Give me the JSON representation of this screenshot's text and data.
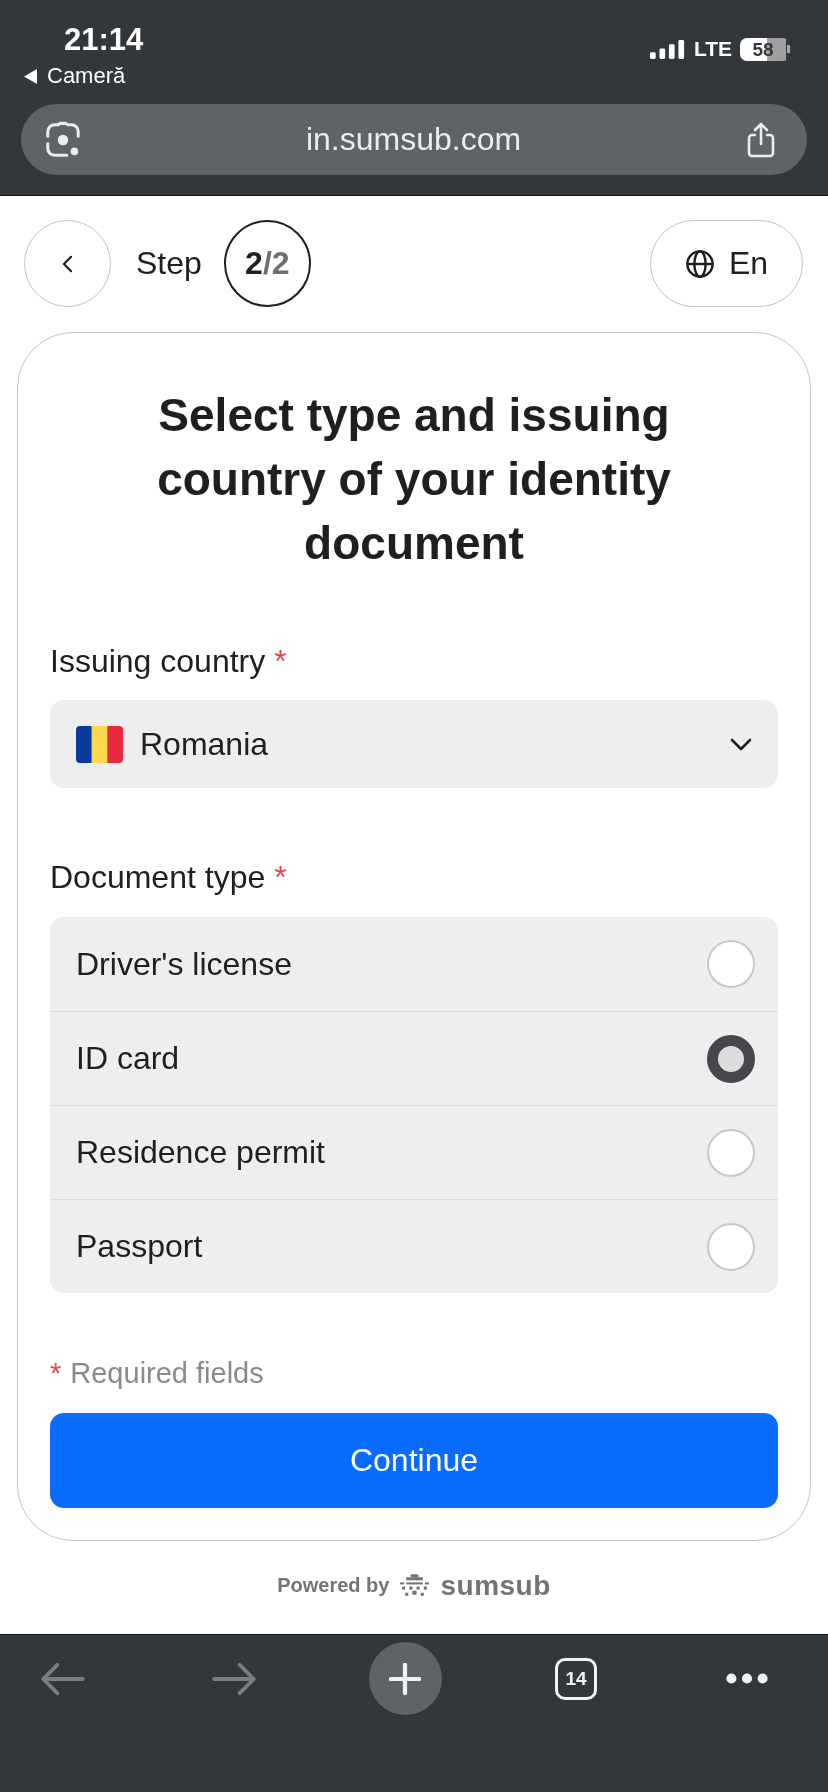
{
  "status_bar": {
    "time": "21:14",
    "back_app": "Cameră",
    "network": "LTE",
    "battery": "58"
  },
  "browser_bar": {
    "url": "in.sumsub.com"
  },
  "header": {
    "step_label": "Step",
    "step_counter": "**2**/2",
    "language": "En"
  },
  "form": {
    "title": "Select type and issuing country of your identity document",
    "country_field": {
      "label": "Issuing country",
      "required_mark": "*",
      "value": "Romania"
    },
    "document_field": {
      "label": "Document type",
      "required_mark": "*",
      "options": [
        {
          "label": "Driver's license",
          "selected": false
        },
        {
          "label": "ID card",
          "selected": true
        },
        {
          "label": "Residence permit",
          "selected": false
        },
        {
          "label": "Passport",
          "selected": false
        }
      ]
    },
    "required_note": {
      "mark": "*",
      "text": "Required fields"
    },
    "continue_button": "Continue"
  },
  "footer": {
    "powered_by": "Powered by",
    "brand": "sumsub"
  },
  "toolbar": {
    "back": {
      "disabled": true
    },
    "forward": {
      "disabled": true
    },
    "tab_count": "14"
  }
}
